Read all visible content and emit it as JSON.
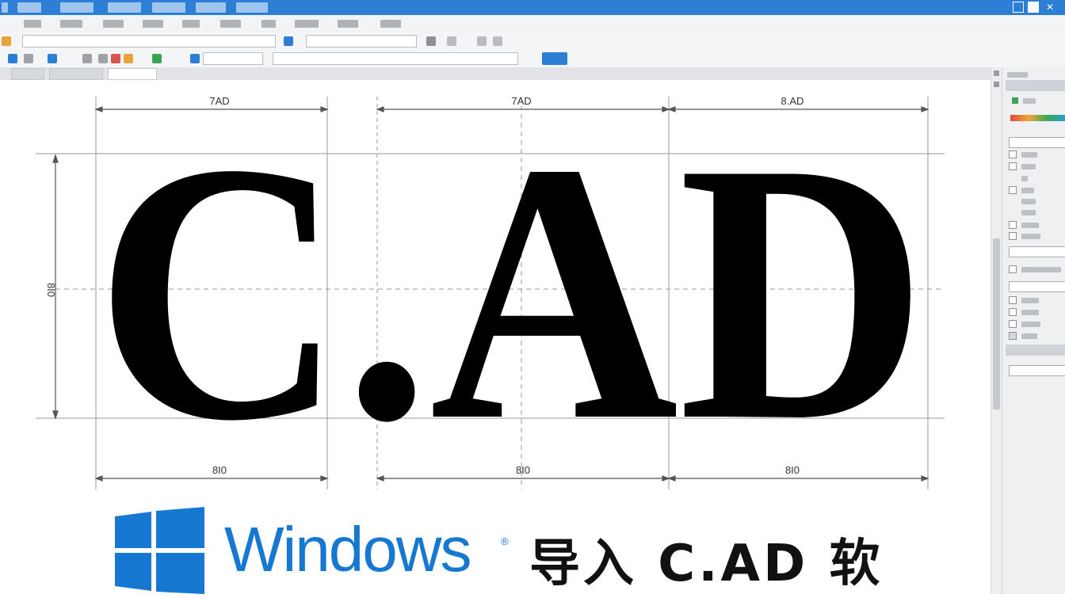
{
  "canvas": {
    "big_text": "C.AD",
    "dims_top": [
      "7AD",
      "7AD",
      "8.AD"
    ],
    "dims_bottom": [
      "8I0",
      "8I0",
      "8I0"
    ],
    "dim_left": "8I0"
  },
  "banner": {
    "windows_word": "Windows",
    "registered": "®",
    "caption": "导入 C.AD 软"
  },
  "colors": {
    "titlebar": "#2d7fd6",
    "windows_blue": "#1778d2",
    "ink": "#111111"
  },
  "icons": [
    "windows-logo-icon",
    "restore-icon",
    "close-icon"
  ]
}
